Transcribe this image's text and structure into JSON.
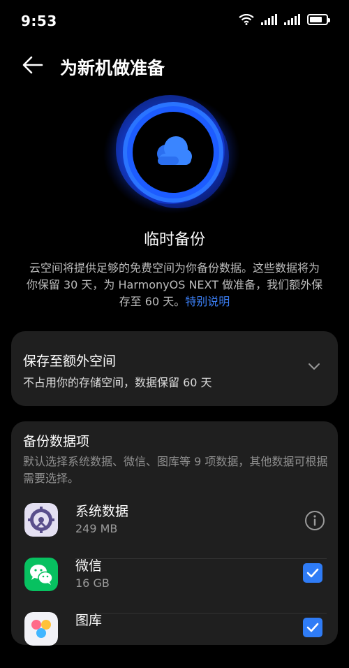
{
  "status_bar": {
    "time": "9:53",
    "battery_level": 0.75
  },
  "header": {
    "title": "为新机做准备"
  },
  "hero": {
    "title": "临时备份",
    "icon": "cloud-icon"
  },
  "description": {
    "text": "云空间将提供足够的免费空间为你备份数据。这些数据将为你保留 30 天，为 HarmonyOS NEXT 做准备，我们额外保存至 60 天。",
    "link": "特别说明"
  },
  "storage_option": {
    "title": "保存至额外空间",
    "subtitle": "不占用你的存储空间，数据保留 60 天"
  },
  "backup_items": {
    "title": "备份数据项",
    "subtitle": "默认选择系统数据、微信、图库等 9 项数据，其他数据可根据需要选择。",
    "items": [
      {
        "name": "系统数据",
        "size": "249 MB",
        "icon": "system-data-icon",
        "action": "info"
      },
      {
        "name": "微信",
        "size": "16 GB",
        "icon": "wechat-icon",
        "action": "checked"
      },
      {
        "name": "图库",
        "size": "",
        "icon": "gallery-icon",
        "action": "checked"
      }
    ]
  },
  "colors": {
    "accent": "#3b7ff6",
    "wechat": "#07c160",
    "card": "#1f1f1f"
  }
}
